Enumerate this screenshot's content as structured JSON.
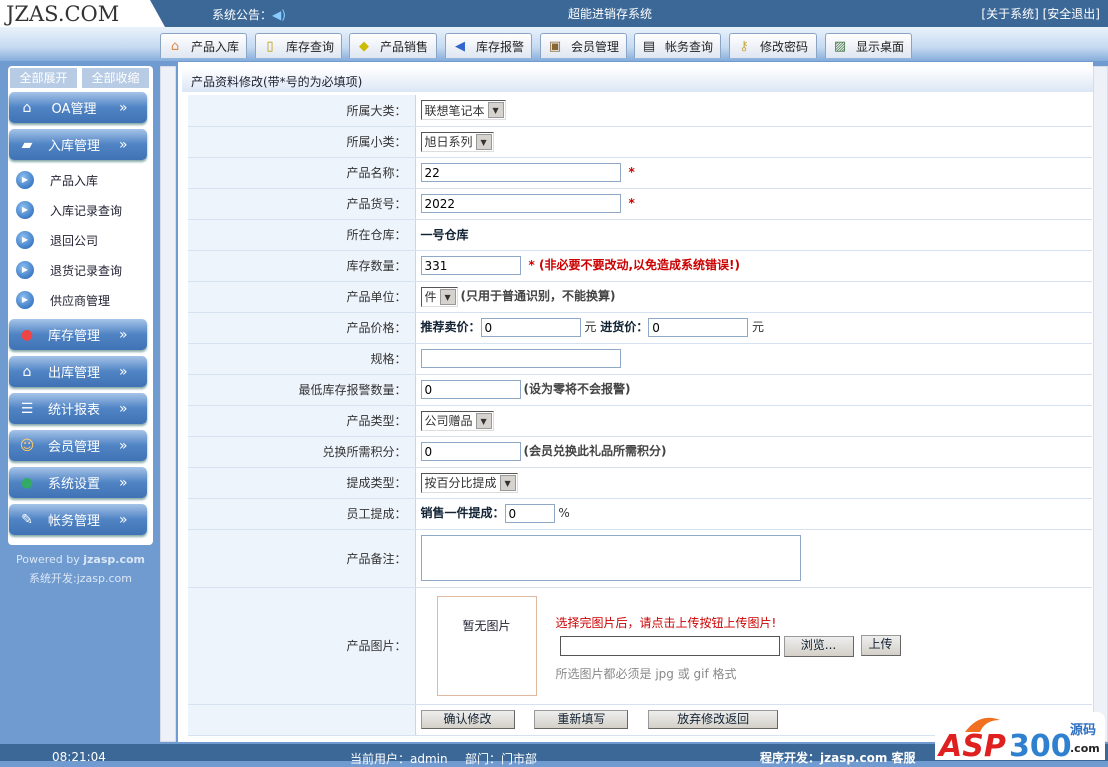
{
  "header": {
    "logo": "JZAS.COM",
    "notice_label": "系统公告：",
    "system_name": "超能进销存系统",
    "about": "[关于系统]",
    "logout": "[安全退出]"
  },
  "nav": [
    {
      "label": "产品入库",
      "icon": "house-icon"
    },
    {
      "label": "库存查询",
      "icon": "book-icon"
    },
    {
      "label": "产品销售",
      "icon": "tag-icon"
    },
    {
      "label": "库存报警",
      "icon": "speaker-icon"
    },
    {
      "label": "会员管理",
      "icon": "person-icon"
    },
    {
      "label": "帐务查询",
      "icon": "clipboard-icon"
    },
    {
      "label": "修改密码",
      "icon": "key-icon"
    },
    {
      "label": "显示桌面",
      "icon": "desktop-icon"
    }
  ],
  "sidebar": {
    "expand_all": "全部展开",
    "collapse_all": "全部收缩",
    "groups": [
      {
        "label": "OA管理"
      },
      {
        "label": "入库管理"
      },
      {
        "label": "库存管理"
      },
      {
        "label": "出库管理"
      },
      {
        "label": "统计报表"
      },
      {
        "label": "会员管理"
      },
      {
        "label": "系统设置"
      },
      {
        "label": "帐务管理"
      }
    ],
    "arrow": "»",
    "sub_items": [
      "产品入库",
      "入库记录查询",
      "退回公司",
      "退货记录查询",
      "供应商管理"
    ],
    "powered_prefix": "Powered by ",
    "powered_brand": "jzasp.com",
    "developer": "系统开发:jzasp.com"
  },
  "form": {
    "title": "产品资料修改(带*号的为必填项)",
    "category_label": "所属大类：",
    "category_value": "联想笔记本",
    "subcategory_label": "所属小类：",
    "subcategory_value": "旭日系列",
    "name_label": "产品名称：",
    "name_value": "22",
    "code_label": "产品货号：",
    "code_value": "2022",
    "required_mark": "*",
    "warehouse_label": "所在仓库：",
    "warehouse_value": "一号仓库",
    "stock_label": "库存数量：",
    "stock_value": "331",
    "stock_warning": "* (非必要不要改动,以免造成系统错误!)",
    "unit_label": "产品单位：",
    "unit_value": "件",
    "unit_hint": "(只用于普通识别，不能换算)",
    "price_label": "产品价格：",
    "sell_price_label": "推荐卖价：",
    "sell_price_value": "0",
    "currency": "元",
    "buy_price_label": "进货价：",
    "buy_price_value": "0",
    "spec_label": "规格：",
    "spec_value": "",
    "min_stock_label": "最低库存报警数量：",
    "min_stock_value": "0",
    "min_stock_hint": "(设为零将不会报警)",
    "type_label": "产品类型：",
    "type_value": "公司赠品",
    "points_label": "兑换所需积分：",
    "points_value": "0",
    "points_hint": "(会员兑换此礼品所需积分)",
    "commission_type_label": "提成类型：",
    "commission_type_value": "按百分比提成",
    "commission_label": "员工提成：",
    "commission_per_label": "销售一件提成：",
    "commission_value": "0",
    "percent": "%",
    "remark_label": "产品备注：",
    "remark_value": "",
    "image_label": "产品图片：",
    "no_image": "暂无图片",
    "upload_tip": "选择完图片后，请点击上传按钮上传图片!",
    "browse": "浏览...",
    "upload": "上传",
    "format_tip": "所选图片都必须是 jpg 或 gif 格式",
    "confirm": "确认修改",
    "reset": "重新填写",
    "cancel": "放弃修改返回"
  },
  "footer": {
    "time": "08:21:04",
    "user": "当前用户：admin",
    "dept": "部门：门市部",
    "dev": "程序开发：jzasp.com 客服"
  },
  "watermark": {
    "text": "ASP300源码 .com"
  }
}
